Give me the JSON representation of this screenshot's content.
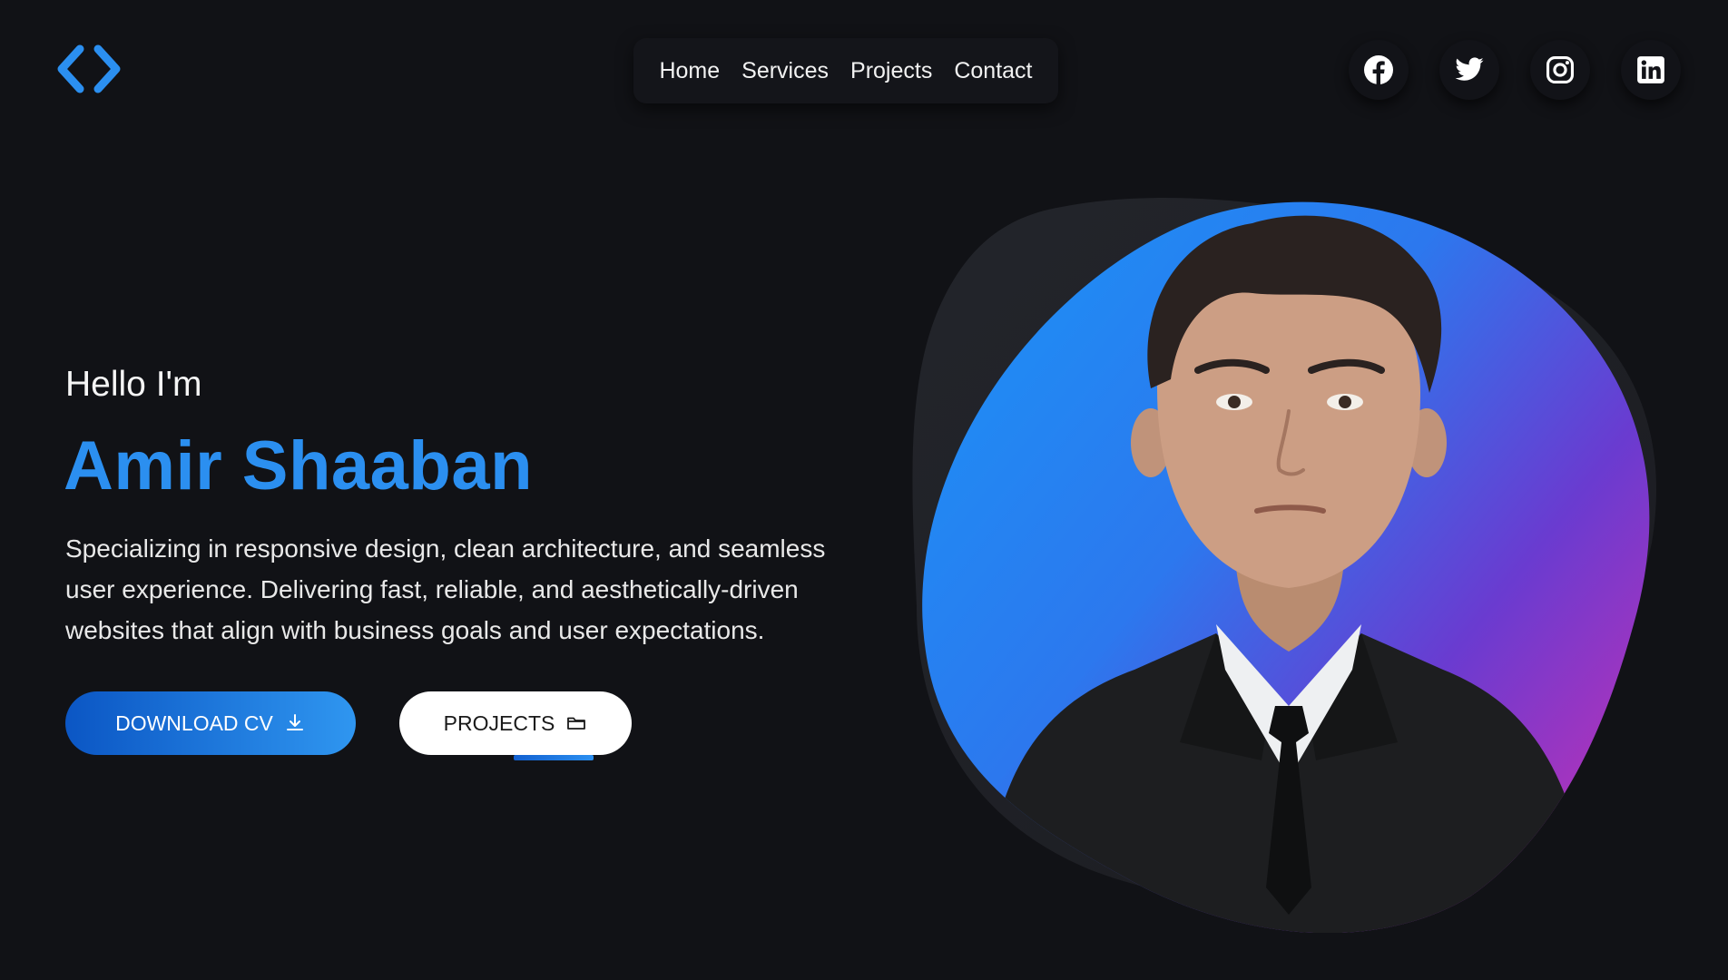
{
  "header": {
    "logo_icon": "code-brackets-icon",
    "nav": [
      {
        "label": "Home"
      },
      {
        "label": "Services"
      },
      {
        "label": "Projects"
      },
      {
        "label": "Contact"
      }
    ],
    "socials": [
      {
        "icon": "facebook-icon"
      },
      {
        "icon": "twitter-icon"
      },
      {
        "icon": "instagram-icon"
      },
      {
        "icon": "linkedin-icon"
      }
    ]
  },
  "hero": {
    "greeting": "Hello I'm",
    "name": "Amir Shaaban",
    "description": "Specializing in responsive design, clean architecture, and seamless user experience. Delivering fast, reliable, and aesthetically-driven websites that align with business goals and user expectations.",
    "buttons": {
      "download_cv": {
        "label": "DOWNLOAD CV",
        "icon": "download-icon"
      },
      "projects": {
        "label": "PROJECTS",
        "icon": "folder-icon"
      }
    }
  },
  "portrait": {
    "icon": "profile-photo"
  },
  "colors": {
    "background": "#111216",
    "accent": "#2b8ff0",
    "gradient_start": "#1e8ef5",
    "gradient_mid": "#6a3bd0",
    "gradient_end": "#d42fb0"
  }
}
